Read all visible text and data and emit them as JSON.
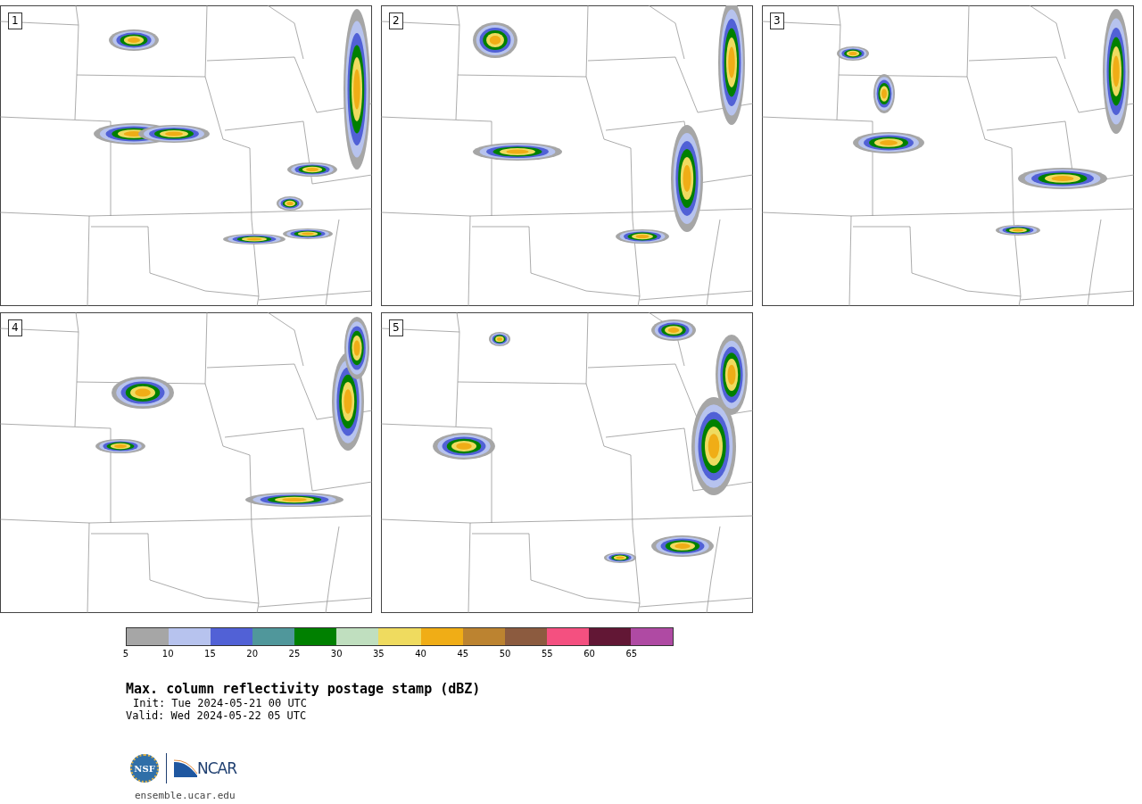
{
  "panels": [
    {
      "label": "1"
    },
    {
      "label": "2"
    },
    {
      "label": "3"
    },
    {
      "label": "4"
    },
    {
      "label": "5"
    }
  ],
  "colorbar": {
    "bins": [
      {
        "color": "#a6a6a6"
      },
      {
        "color": "#b7c3ee"
      },
      {
        "color": "#5161d6"
      },
      {
        "color": "#50979b"
      },
      {
        "color": "#008000"
      },
      {
        "color": "#c0dfbf"
      },
      {
        "color": "#efdb5f"
      },
      {
        "color": "#f0ad16"
      },
      {
        "color": "#bc8330"
      },
      {
        "color": "#8c5b3f"
      },
      {
        "color": "#f45080"
      },
      {
        "color": "#621735"
      },
      {
        "color": "#af4aa3"
      }
    ],
    "ticks": [
      "5",
      "10",
      "15",
      "20",
      "25",
      "30",
      "35",
      "40",
      "45",
      "50",
      "55",
      "60",
      "65"
    ]
  },
  "title": "Max. column reflectivity postage stamp (dBZ)",
  "init": "Init: Tue 2024-05-21 00 UTC",
  "valid": "Valid: Wed 2024-05-22 05 UTC",
  "logos": {
    "left": "NSF",
    "right": "NCAR"
  },
  "url": "ensemble.ucar.edu"
}
